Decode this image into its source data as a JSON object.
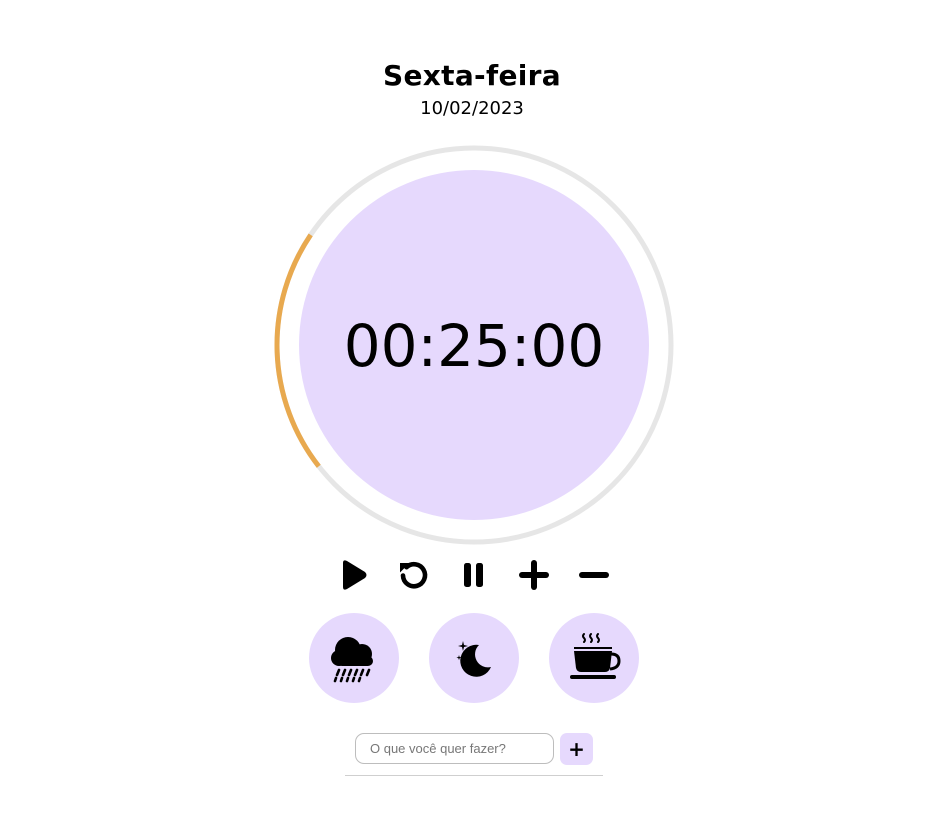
{
  "header": {
    "day": "Sexta-feira",
    "date": "10/02/2023"
  },
  "timer": {
    "time": "00:25:00",
    "progress_fraction": 0.2,
    "colors": {
      "face": "#e6d9fd",
      "track": "#e6e6e6",
      "progress": "#e8a94f"
    }
  },
  "controls": [
    {
      "name": "play-icon"
    },
    {
      "name": "reset-icon"
    },
    {
      "name": "pause-icon"
    },
    {
      "name": "plus-icon"
    },
    {
      "name": "minus-icon"
    }
  ],
  "sounds": [
    {
      "name": "rain-cloud-icon"
    },
    {
      "name": "moon-stars-icon"
    },
    {
      "name": "coffee-cup-icon"
    }
  ],
  "task": {
    "placeholder": "O que você quer fazer?",
    "add_label": "+"
  }
}
